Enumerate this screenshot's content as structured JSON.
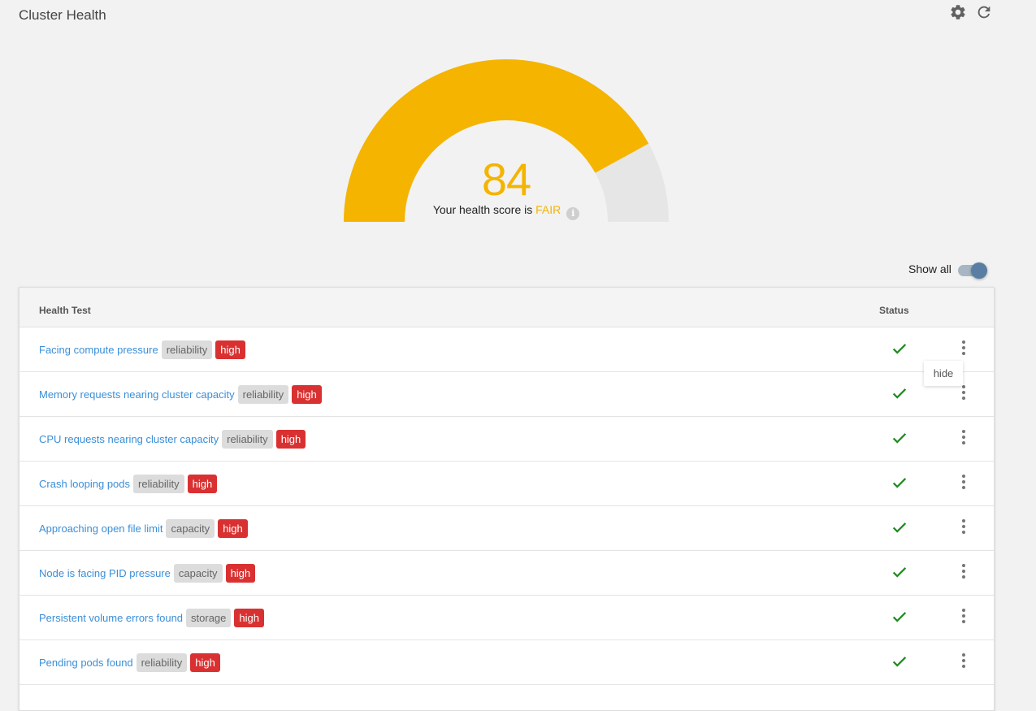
{
  "header": {
    "title": "Cluster Health",
    "icons": [
      "gear-icon",
      "refresh-icon"
    ]
  },
  "gauge": {
    "score": "84",
    "score_value": 84,
    "max": 100,
    "label_prefix": "Your health score is",
    "rating": "FAIR",
    "fill_color": "#f4b400",
    "track_color": "#e6e6e6"
  },
  "filter": {
    "show_all_label": "Show all",
    "show_all_on": true
  },
  "table": {
    "headers": {
      "test": "Health Test",
      "status": "Status"
    },
    "rows": [
      {
        "name": "Facing compute pressure",
        "category": "reliability",
        "severity": "high",
        "status": "check-icon"
      },
      {
        "name": "Memory requests nearing cluster capacity",
        "category": "reliability",
        "severity": "high",
        "status": "check-icon"
      },
      {
        "name": "CPU requests nearing cluster capacity",
        "category": "reliability",
        "severity": "high",
        "status": "check-icon"
      },
      {
        "name": "Crash looping pods",
        "category": "reliability",
        "severity": "high",
        "status": "check-icon"
      },
      {
        "name": "Approaching open file limit",
        "category": "capacity",
        "severity": "high",
        "status": "check-icon"
      },
      {
        "name": "Node is facing PID pressure",
        "category": "capacity",
        "severity": "high",
        "status": "check-icon"
      },
      {
        "name": "Persistent volume errors found",
        "category": "storage",
        "severity": "high",
        "status": "check-icon"
      },
      {
        "name": "Pending pods found",
        "category": "reliability",
        "severity": "high",
        "status": "check-icon"
      }
    ]
  },
  "tooltip": {
    "label": "hide"
  },
  "colors": {
    "accent": "#f4b400",
    "link": "#3a8ed8",
    "severity_high": "#d93131",
    "status_ok": "#1e8a1e"
  }
}
